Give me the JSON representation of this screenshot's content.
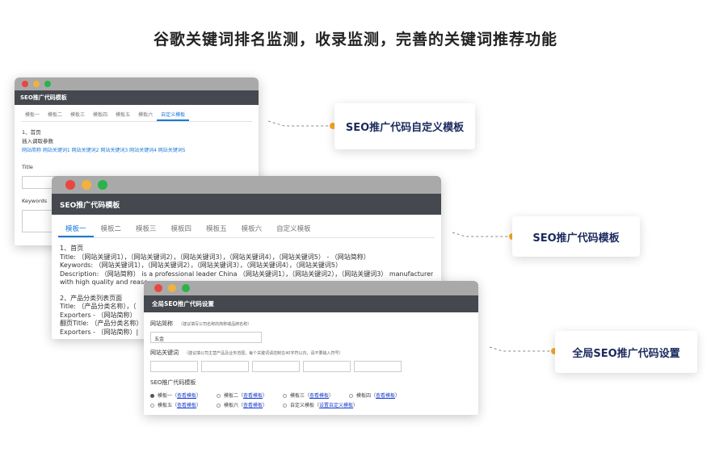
{
  "headline": "谷歌关键词排名监测，收录监测，完善的关键词推荐功能",
  "colors": {
    "accent": "#1a7ad6",
    "callout_text": "#1a2a5e",
    "connector_dot": "#f5a623",
    "titlebar": "#45484e"
  },
  "callouts": {
    "custom_template": "SEO推广代码自定义模板",
    "template": "SEO推广代码模板",
    "global_settings": "全局SEO推广代码设置"
  },
  "win1": {
    "title": "SEO推广代码模板",
    "tabs": [
      "模板一",
      "模板二",
      "模板三",
      "模板四",
      "模板五",
      "模板六",
      "自定义模板"
    ],
    "section": "1、首页",
    "insert_label": "插入调取参数",
    "params": "网站简称 网站关键词1 网站关键词2 网站关键词3 网站关键词4 网站关键词5",
    "field_title": "Title",
    "field_keywords": "Keywords"
  },
  "win2": {
    "title": "SEO推广代码模板",
    "tabs": [
      "模板一",
      "模板二",
      "模板三",
      "模板四",
      "模板五",
      "模板六",
      "自定义模板"
    ],
    "lines": [
      "1、首页",
      "Title: （网站关键词1），（网站关键词2），（网站关键词3），（网站关键词4），（网站关键词5） - （网站简称）",
      "Keywords: （网站关键词1），（网站关键词2），（网站关键词3），（网站关键词4），（网站关键词5）",
      "Description: （网站简称） is a professional leader China （网站关键词1），（网站关键词2），（网站关键词3） manufacturer",
      "with high quality and reaso"
    ],
    "lines2": [
      "2、产品分类列表页面",
      "Title: （产品分类名称），（",
      "Exporters - （网站简称）",
      "翻页Title: （产品分类名称）",
      "Exporters - （网站简称）|"
    ]
  },
  "win3": {
    "title": "全局SEO推广代码设置",
    "site_name_label": "网站简称",
    "site_name_hint": "（建议填写公司名称的简称或品牌名称）",
    "site_name_value": "五金",
    "keywords_label": "网站关键词",
    "keywords_hint": "（建议填公司主营产品及业务范围，每个关键词请控制在40字符以内，请不要输入符号）",
    "template_label": "SEO推广代码模板",
    "options": [
      {
        "name": "模板一",
        "link": "查看模板",
        "checked": true
      },
      {
        "name": "模板二",
        "link": "查看模板",
        "checked": false
      },
      {
        "name": "模板三",
        "link": "查看模板",
        "checked": false
      },
      {
        "name": "模板四",
        "link": "查看模板",
        "checked": false
      },
      {
        "name": "模板五",
        "link": "查看模板",
        "checked": false
      },
      {
        "name": "模板六",
        "link": "查看模板",
        "checked": false
      },
      {
        "name": "自定义模板",
        "link": "设置自定义模板",
        "checked": false
      }
    ]
  }
}
